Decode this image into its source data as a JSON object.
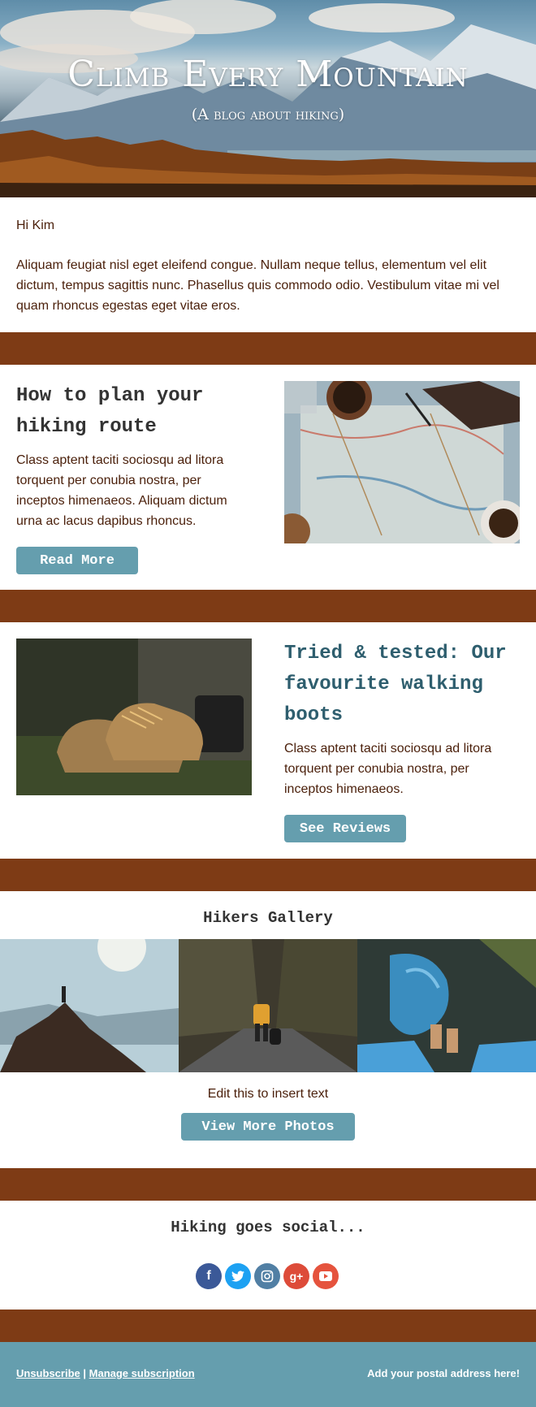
{
  "header": {
    "title": "Climb Every Mountain",
    "subtitle": "(A blog about hiking)"
  },
  "intro": {
    "greeting": "Hi Kim",
    "body": "Aliquam feugiat nisl eget eleifend congue. Nullam neque tellus, elementum vel elit dictum, tempus sagittis nunc. Phasellus quis commodo odio. Vestibulum vitae mi vel quam rhoncus egestas eget vitae eros."
  },
  "articles": [
    {
      "title": "How to plan your hiking route",
      "body": "Class aptent taciti sociosqu ad litora torquent per conubia nostra, per inceptos himenaeos. Aliquam dictum urna ac lacus dapibus rhoncus.",
      "button": "Read More",
      "title_color": "#333333"
    },
    {
      "title": "Tried & tested: Our favourite walking boots",
      "body": "Class aptent taciti sociosqu ad litora torquent per conubia nostra, per inceptos himenaeos.",
      "button": "See Reviews",
      "title_color": "#2e5e6e"
    }
  ],
  "gallery": {
    "title": "Hikers Gallery",
    "note": "Edit this to insert text",
    "button": "View More Photos"
  },
  "social": {
    "title": "Hiking goes social...",
    "icons": [
      {
        "name": "facebook-icon",
        "glyph": "f",
        "color": "#3b5998"
      },
      {
        "name": "twitter-icon",
        "glyph": "t",
        "color": "#1da1f2"
      },
      {
        "name": "instagram-icon",
        "glyph": "◎",
        "color": "#517fa4"
      },
      {
        "name": "google-plus-icon",
        "glyph": "g+",
        "color": "#dd4b39"
      },
      {
        "name": "youtube-icon",
        "glyph": "▶",
        "color": "#e5533d"
      }
    ]
  },
  "footer": {
    "unsubscribe": "Unsubscribe",
    "separator": "|",
    "manage": "Manage subscription",
    "address": "Add your postal address here!"
  },
  "colors": {
    "divider": "#7e3b15",
    "accent": "#659eae",
    "text_brown": "#4a1f0a"
  }
}
